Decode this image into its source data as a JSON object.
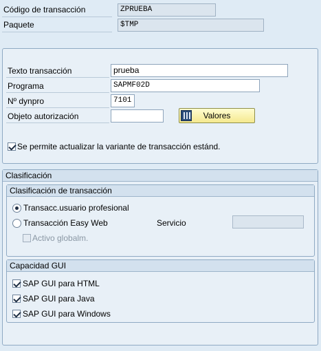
{
  "header": {
    "tcode_label": "Código de transacción",
    "tcode_value": "ZPRUEBA",
    "package_label": "Paquete",
    "package_value": "$TMP"
  },
  "details": {
    "text_label": "Texto transacción",
    "text_value": "prueba",
    "program_label": "Programa",
    "program_value": "SAPMF02D",
    "dynpro_label": "Nº dynpro",
    "dynpro_value": "7101",
    "auth_label": "Objeto autorización",
    "auth_value": "",
    "values_button": "Valores",
    "variant_checkbox_label": "Se permite actualizar la variante de transacción estánd.",
    "variant_checked": true
  },
  "classification": {
    "title": "Clasificación",
    "transaction_group": {
      "title": "Clasificación de transacción",
      "option_professional": "Transacc.usuario profesional",
      "option_easyweb": "Transacción Easy Web",
      "service_label": "Servicio",
      "service_value": "",
      "global_label": "Activo globalm.",
      "selected": "professional"
    },
    "gui_group": {
      "title": "Capacidad GUI",
      "html": "SAP GUI para HTML",
      "java": "SAP GUI para Java",
      "windows": "SAP GUI para Windows"
    }
  }
}
